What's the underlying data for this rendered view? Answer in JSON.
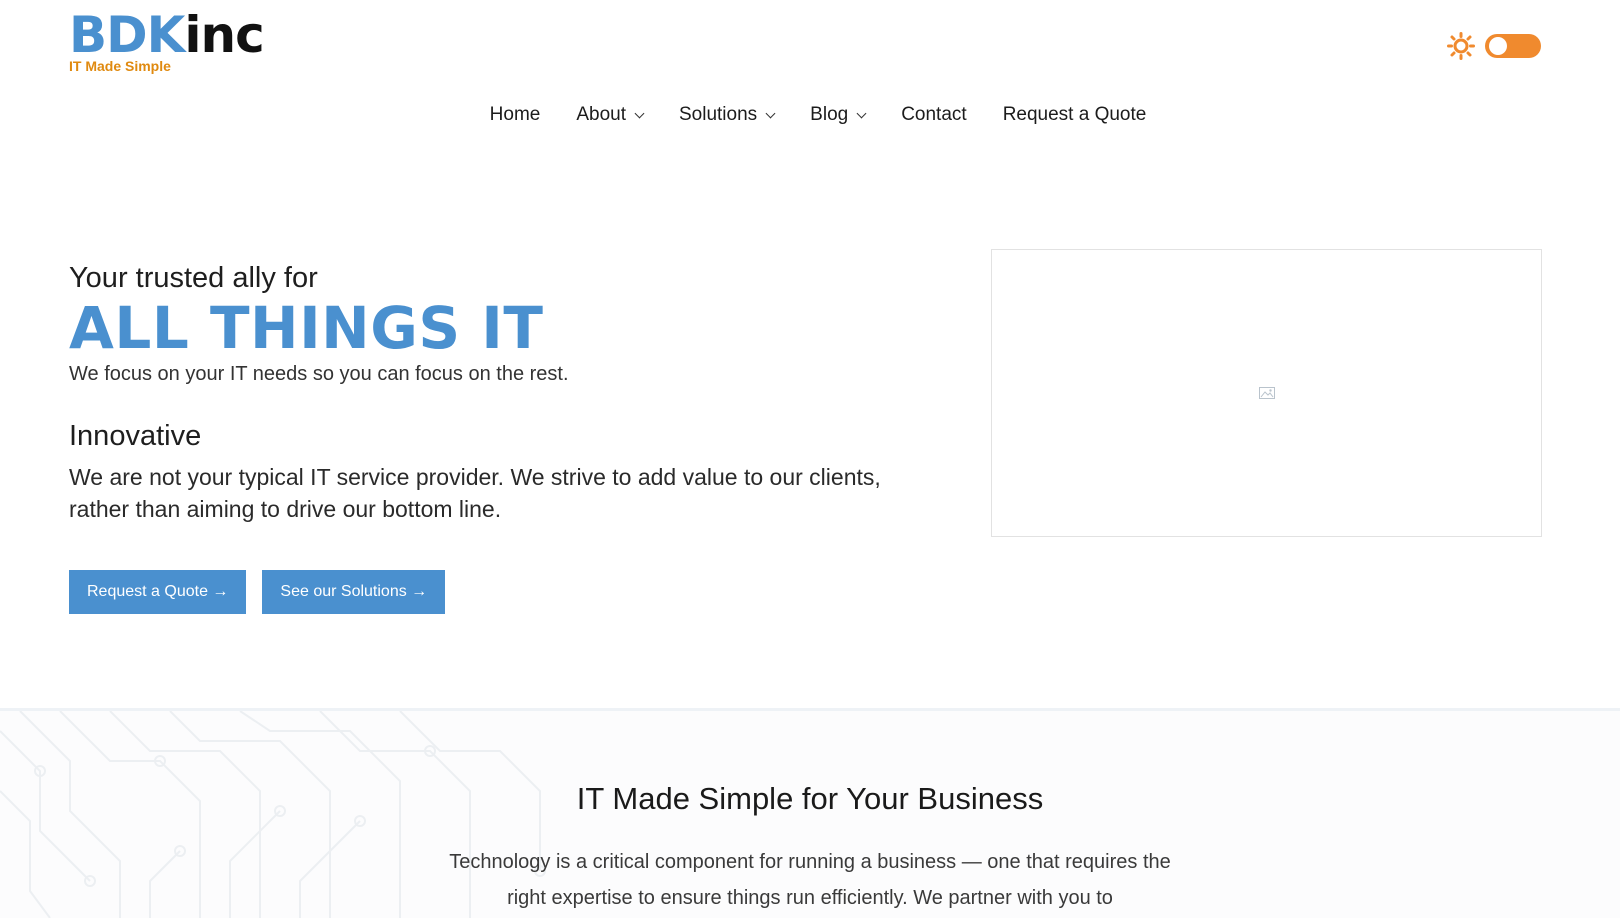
{
  "logo": {
    "brand_primary": "BDK",
    "brand_secondary": "inc",
    "tagline": "IT Made Simple"
  },
  "theme": {
    "sun_icon": "sun-icon",
    "toggle_color": "#f08a2e"
  },
  "nav": {
    "items": [
      {
        "label": "Home"
      },
      {
        "label": "About"
      },
      {
        "label": "Solutions"
      },
      {
        "label": "Blog"
      },
      {
        "label": "Contact"
      },
      {
        "label": "Request a Quote"
      }
    ]
  },
  "hero": {
    "pre": "Your trusted ally for",
    "title": "ALL THINGS IT",
    "subtitle": "We focus on your IT needs so you can focus on the rest.",
    "feature_heading": "Innovative",
    "feature_text": "We are not your typical IT service provider. We strive to add value to our clients, rather than aiming to drive our bottom line.",
    "buttons": [
      {
        "label": "Request a Quote →"
      },
      {
        "label": "See our Solutions →"
      }
    ],
    "image_icon": "image-placeholder-icon"
  },
  "section2": {
    "title": "IT Made Simple for Your Business",
    "text": "Technology is a critical component for running a business — one that requires the right expertise to ensure things run efficiently. We partner with you to"
  },
  "colors": {
    "accent": "#4a90cf",
    "tagline": "#e08a10"
  }
}
